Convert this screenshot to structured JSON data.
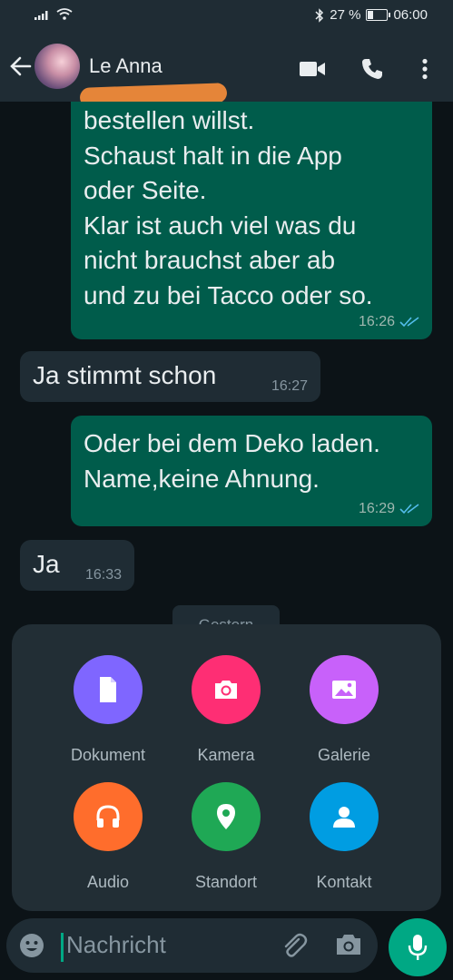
{
  "status": {
    "battery": "27 %",
    "battery_level": 0.27,
    "time": "06:00"
  },
  "header": {
    "contact_name": "Le    Anna"
  },
  "messages": [
    {
      "dir": "out",
      "text": "bestellen willst.\nSchaust halt in die App\noder Seite.\nKlar ist auch viel was du\nnicht brauchst aber ab\nund zu bei Tacco oder so.",
      "time": "16:26",
      "status": "read"
    },
    {
      "dir": "in",
      "text": "Ja stimmt schon",
      "time": "16:27"
    },
    {
      "dir": "out",
      "text": "Oder bei dem Deko laden.\nName,keine Ahnung.",
      "time": "16:29",
      "status": "read"
    },
    {
      "dir": "in",
      "text": "Ja",
      "time": "16:33"
    }
  ],
  "date_divider": "Gestern",
  "attach": [
    {
      "label": "Dokument",
      "color": "#7f66ff",
      "icon": "document-icon"
    },
    {
      "label": "Kamera",
      "color": "#fe2e74",
      "icon": "camera-icon"
    },
    {
      "label": "Galerie",
      "color": "#c861fa",
      "icon": "gallery-icon"
    },
    {
      "label": "Audio",
      "color": "#ff6d2c",
      "icon": "headphones-icon"
    },
    {
      "label": "Standort",
      "color": "#1fa855",
      "icon": "location-icon"
    },
    {
      "label": "Kontakt",
      "color": "#009de2",
      "icon": "contact-icon"
    }
  ],
  "input": {
    "placeholder": "Nachricht"
  },
  "colors": {
    "accent": "#00a884",
    "outgoing": "#005c4b",
    "incoming": "#1f2c34",
    "read_ticks": "#53bdeb"
  }
}
